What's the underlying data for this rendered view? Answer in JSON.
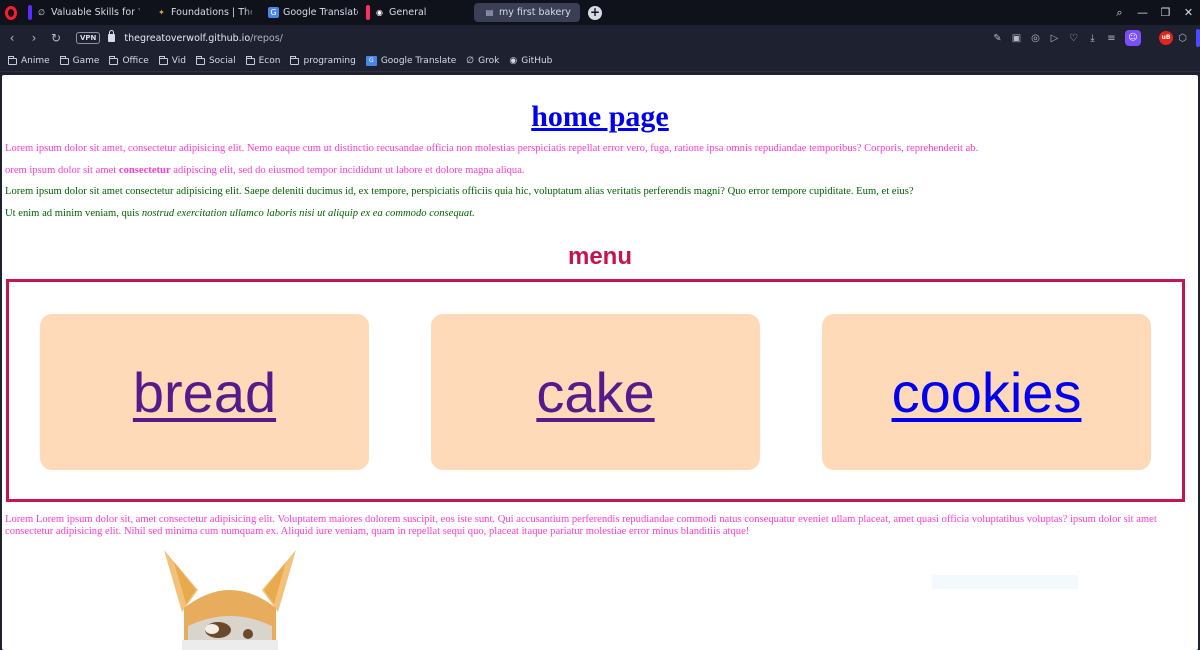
{
  "browser": {
    "tabs": [
      {
        "title": "Valuable Skills for Young A",
        "marker": "#5b2cff",
        "fav": "∅"
      },
      {
        "title": "Foundations | The Odin Pr",
        "marker": "",
        "fav": "✦"
      },
      {
        "title": "Google Translate",
        "marker": "",
        "fav": "G"
      },
      {
        "title": "General",
        "marker": "#ff2e5b",
        "fav": "◉"
      },
      {
        "title": "my first bakery",
        "marker": "",
        "fav": "▤",
        "active": true
      }
    ],
    "address": {
      "vpn_label": "VPN",
      "url_host": "thegreatoverwolf.github.io",
      "url_path": "/repos/"
    },
    "extension_badge": "uB",
    "bookmarks": [
      {
        "label": "Anime",
        "type": "folder"
      },
      {
        "label": "Game",
        "type": "folder"
      },
      {
        "label": "Office",
        "type": "folder"
      },
      {
        "label": "Vid",
        "type": "folder"
      },
      {
        "label": "Social",
        "type": "folder"
      },
      {
        "label": "Econ",
        "type": "folder"
      },
      {
        "label": "programing",
        "type": "folder"
      },
      {
        "label": "Google Translate",
        "type": "gt"
      },
      {
        "label": "Grok",
        "type": "grok"
      },
      {
        "label": "GitHub",
        "type": "github"
      }
    ]
  },
  "page": {
    "title": "home page",
    "p1": "Lorem ipsum dolor sit amet, consectetur adipisicing elit. Nemo eaque cum ut distinctio recusandae officia non molestias perspiciatis repellat error vero, fuga, ratione ipsa omnis repudiandae temporibus? Corporis, reprehenderit ab.",
    "p2_a": "orem ipsum dolor sit amet ",
    "p2_bold": "consectetur",
    "p2_b": " adipiscing elit, sed do eiusmod tempor incididunt ut labore et dolore magna aliqua.",
    "p3": "Lorem ipsum dolor sit amet consectetur adipisicing elit. Saepe deleniti ducimus id, ex tempore, perspiciatis officiis quia hic, voluptatum alias veritatis perferendis magni? Quo error tempore cupiditate. Eum, et eius?",
    "p4_a": "Ut enim ad minim veniam, quis ",
    "p4_italic": "nostrud exercitation ullamco laboris nisi ut aliquip ex ea commodo consequat.",
    "menu_title": "menu",
    "menu_items": [
      "bread",
      "cake",
      "cookies"
    ],
    "p5": "Lorem Lorem ipsum dolor sit, amet consectetur adipisicing elit. Voluptatem maiores dolorem suscipit, eos iste sunt. Qui accusantium perferendis repudiandae commodi natus consequatur eveniet ullam placeat, amet quasi officia voluptatibus voluptas? ipsum dolor sit amet consectetur adipisicing elit. Nihil sed minima cum numquam ex. Aliquid iure veniam, quam in repellat sequi quo, placeat itaque pariatur molestiae error minus blanditiis atque!"
  },
  "colors": {
    "link": "#0000ee",
    "visited": "#551a8b",
    "menu_accent": "#c41550",
    "card_bg": "#ffdab9",
    "pink_text": "#ff3ad2",
    "green_text": "#006400"
  }
}
